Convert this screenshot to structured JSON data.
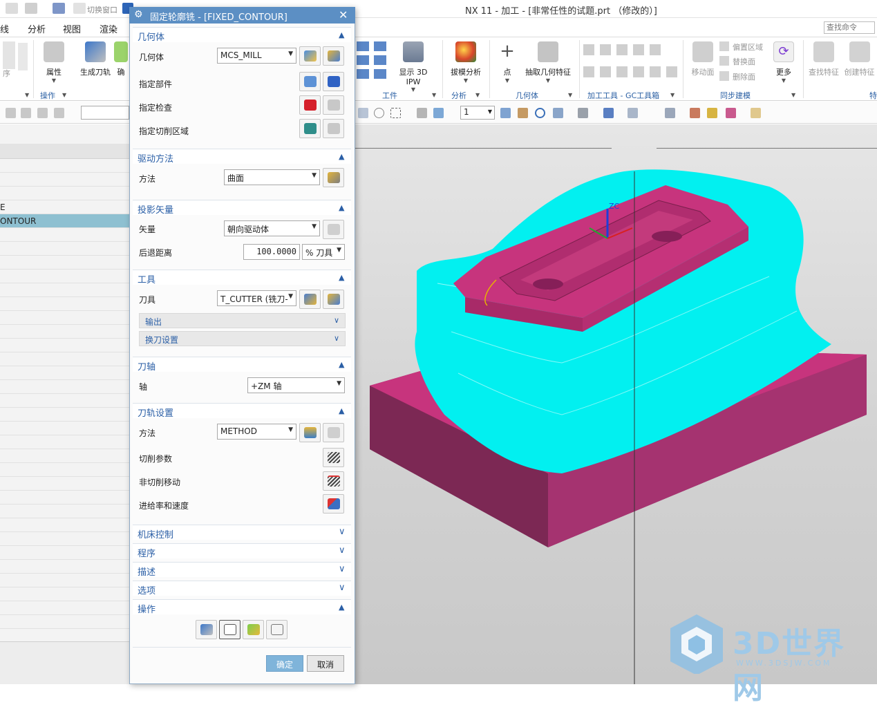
{
  "window": {
    "title": "NX 11 - 加工 - [非常任性的试题.prt （修改的）]"
  },
  "quick_access": {
    "switch_window": "切换窗口",
    "window_menu": "窗口"
  },
  "menu": [
    "线",
    "分析",
    "视图",
    "渲染"
  ],
  "search": {
    "placeholder": "查找命令"
  },
  "ribbon": {
    "buttons": {
      "properties": "属性",
      "generate_toolpath": "生成刀轨",
      "confirm": "确",
      "show_3d_ipw": "显示 3D IPW",
      "draft_analysis": "拔模分析",
      "point": "点",
      "extract_geometry": "抽取几何特征",
      "move_face": "移动面",
      "offset_region": "偏置区域",
      "replace_face": "替换面",
      "delete_face": "删除面",
      "more": "更多",
      "find_feature": "查找特征",
      "create_feature": "创建特征",
      "left_cut": "序"
    },
    "groups": {
      "operation": "操作",
      "workpiece": "工件",
      "analysis": "分析",
      "geometry": "几何体",
      "gc_tools": "加工工具 - GC工具箱",
      "sync_modeling": "同步建模",
      "feature": "特"
    }
  },
  "toolbar": {
    "layer_value": "1"
  },
  "navigator": {
    "rows": [
      "E",
      "ONTOUR"
    ]
  },
  "dialog": {
    "title": "固定轮廓铣 - [FIXED_CONTOUR]",
    "sections": {
      "geometry": {
        "header": "几何体",
        "geometry_label": "几何体",
        "geometry_value": "MCS_MILL",
        "part_label": "指定部件",
        "check_label": "指定检查",
        "trim_label": "指定切削区域"
      },
      "drive": {
        "header": "驱动方法",
        "method_label": "方法",
        "method_value": "曲面"
      },
      "projection": {
        "header": "投影矢量",
        "vector_label": "矢量",
        "vector_value": "朝向驱动体",
        "retract_label": "后退距离",
        "retract_value": "100.0000",
        "retract_unit": "% 刀具"
      },
      "tool": {
        "header": "工具",
        "tool_label": "刀具",
        "tool_value": "T_CUTTER (铣刀-",
        "output": "输出",
        "tool_change": "换刀设置"
      },
      "axis": {
        "header": "刀轴",
        "axis_label": "轴",
        "axis_value": "+ZM 轴"
      },
      "path": {
        "header": "刀轨设置",
        "method_label": "方法",
        "method_value": "METHOD",
        "cut_params": "切削参数",
        "non_cut_moves": "非切削移动",
        "feeds_speeds": "进给率和速度"
      },
      "collapsed": [
        "机床控制",
        "程序",
        "描述",
        "选项"
      ],
      "actions": {
        "header": "操作"
      }
    },
    "ok": "确定",
    "cancel": "取消"
  },
  "viewport": {
    "axis_label": "ZC"
  },
  "watermark": {
    "title": "3D世界网",
    "url": "WWW.3DSJW.COM"
  },
  "colors": {
    "accent": "#2b5fa6",
    "title_bar": "#5c8fc4",
    "part": "#c7347d",
    "toolpath": "#00f2f2",
    "selection": "#8ec0d1"
  }
}
